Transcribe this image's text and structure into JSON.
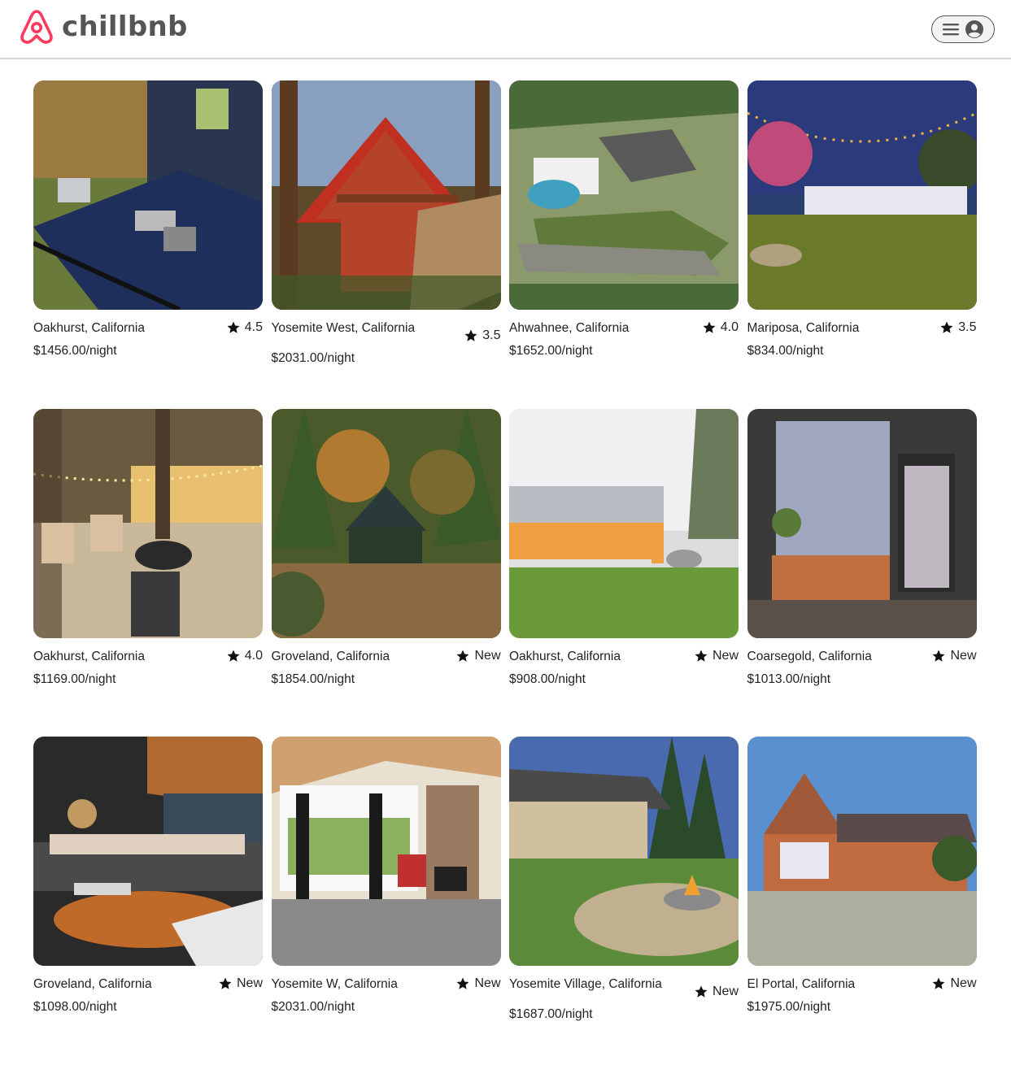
{
  "header": {
    "brand": "chillbnb",
    "logo_color": "#FF385C"
  },
  "listings": [
    {
      "location": "Oakhurst, California",
      "rating": "4.5",
      "price": "$1456.00/night",
      "scene": "deck-cabin",
      "colors": [
        "#6a7a3a",
        "#1f2f5c",
        "#22305a"
      ]
    },
    {
      "location": "Yosemite West, California",
      "rating": "3.5",
      "price": "$2031.00/night",
      "scene": "a-frame",
      "colors": [
        "#5c4a2a",
        "#b5432a",
        "#3f5a2a"
      ]
    },
    {
      "location": "Ahwahnee, California",
      "rating": "4.0",
      "price": "$1652.00/night",
      "scene": "aerial-pool",
      "colors": [
        "#8a9a6a",
        "#5f7a3a",
        "#3fa0c0"
      ]
    },
    {
      "location": "Mariposa, California",
      "rating": "3.5",
      "price": "$834.00/night",
      "scene": "night-lawn",
      "colors": [
        "#2a3e6e",
        "#6a7a2a",
        "#f0b040"
      ]
    },
    {
      "location": "Oakhurst, California",
      "rating": "4.0",
      "price": "$1169.00/night",
      "scene": "firepit-sunset",
      "colors": [
        "#c9b79a",
        "#8a7a60",
        "#f0d090"
      ]
    },
    {
      "location": "Groveland, California",
      "rating": "New",
      "price": "$1854.00/night",
      "scene": "forest-cabin",
      "colors": [
        "#4a5a2a",
        "#b07a30",
        "#2a3a2a"
      ]
    },
    {
      "location": "Oakhurst, California",
      "rating": "New",
      "price": "$908.00/night",
      "scene": "modern-house",
      "colors": [
        "#dcdcdc",
        "#6a9a3a",
        "#f0a040"
      ]
    },
    {
      "location": "Coarsegold, California",
      "rating": "New",
      "price": "$1013.00/night",
      "scene": "wood-facade",
      "colors": [
        "#3a3a3a",
        "#a0a8c0",
        "#c07040"
      ]
    },
    {
      "location": "Groveland, California",
      "rating": "New",
      "price": "$1098.00/night",
      "scene": "living-room",
      "colors": [
        "#3a3a3a",
        "#c06a2a",
        "#e0d0c0"
      ]
    },
    {
      "location": "Yosemite W, California",
      "rating": "New",
      "price": "$2031.00/night",
      "scene": "great-room",
      "colors": [
        "#d0a070",
        "#8a8a8a",
        "#e8e8e8"
      ]
    },
    {
      "location": "Yosemite Village, California",
      "rating": "New",
      "price": "$1687.00/night",
      "scene": "patio-fire",
      "colors": [
        "#4a6ab0",
        "#5a8a3a",
        "#d0c0a0"
      ]
    },
    {
      "location": "El Portal, California",
      "rating": "New",
      "price": "$1975.00/night",
      "scene": "orange-house",
      "colors": [
        "#5a90d0",
        "#c06a40",
        "#b0b0a0"
      ]
    }
  ]
}
